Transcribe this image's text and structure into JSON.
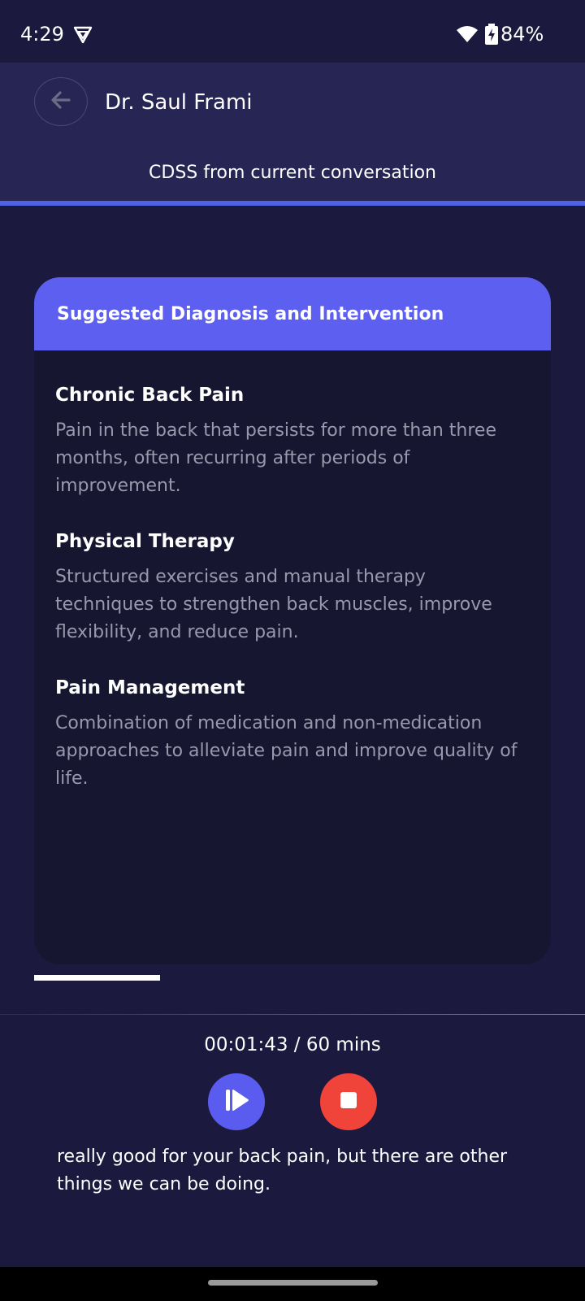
{
  "status_bar": {
    "time": "4:29",
    "battery": "84%",
    "icons": [
      "vpn-icon",
      "wifi-icon",
      "battery-charging-icon"
    ]
  },
  "header": {
    "doctor_name": "Dr. Saul Frami",
    "back_icon": "arrow-left-icon",
    "tab_label": "CDSS from current conversation"
  },
  "card": {
    "title": "Suggested Diagnosis and Intervention",
    "items": [
      {
        "title": "Chronic Back Pain",
        "description": "Pain in the back that persists for more than three months, often recurring after periods of improvement."
      },
      {
        "title": "Physical Therapy",
        "description": "Structured exercises and manual therapy techniques to strengthen back muscles, improve flexibility, and reduce pain."
      },
      {
        "title": "Pain Management",
        "description": "Combination of medication and non-medication approaches to alleviate pain and improve quality of life."
      }
    ]
  },
  "footer": {
    "timer": "00:01:43 / 60 mins",
    "play_icon": "play-pause-icon",
    "stop_icon": "stop-icon",
    "transcript": "really good for your back pain, but there are other things we can be doing."
  },
  "colors": {
    "background": "#1b1a3e",
    "header": "#272554",
    "accent": "#5d5ff0",
    "tab_indicator": "#4e62e6",
    "stop": "#f0433a",
    "card_body": "#161631",
    "muted_text": "#9a98ac"
  }
}
